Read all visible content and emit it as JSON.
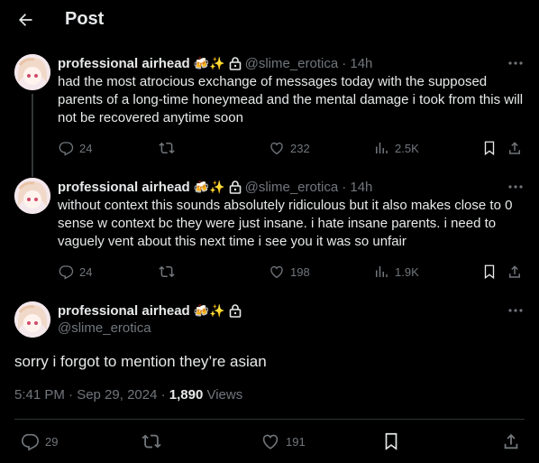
{
  "header": {
    "title": "Post"
  },
  "user": {
    "name": "professional airhead",
    "emoji": "🍻✨",
    "handle": "@slime_erotica"
  },
  "tweets": [
    {
      "time": "· 14h",
      "text": "had the most atrocious exchange of messages today with the supposed parents of a long-time honeymead and the mental damage i took from this will not be recovered anytime soon",
      "replies": "24",
      "likes": "232",
      "views": "2.5K"
    },
    {
      "time": "· 14h",
      "text": "without context this sounds absolutely ridiculous but it also makes close to 0 sense w context bc they were just insane. i hate insane parents. i need to vaguely vent about this next time i see you it was so unfair",
      "replies": "24",
      "likes": "198",
      "views": "1.9K"
    }
  ],
  "focal": {
    "text": "sorry i forgot to mention they’re asian",
    "timestamp": "5:41 PM · Sep 29, 2024 · ",
    "views_count": "1,890",
    "views_label": " Views",
    "replies": "29",
    "likes": "191"
  },
  "colors": {
    "background": "#000000",
    "text": "#e7e9ea",
    "muted": "#71767b",
    "divider": "#2f3336"
  },
  "icons": [
    "back-arrow-icon",
    "lock-icon",
    "more-icon",
    "reply-icon",
    "retweet-icon",
    "like-icon",
    "views-icon",
    "bookmark-icon",
    "share-icon"
  ]
}
